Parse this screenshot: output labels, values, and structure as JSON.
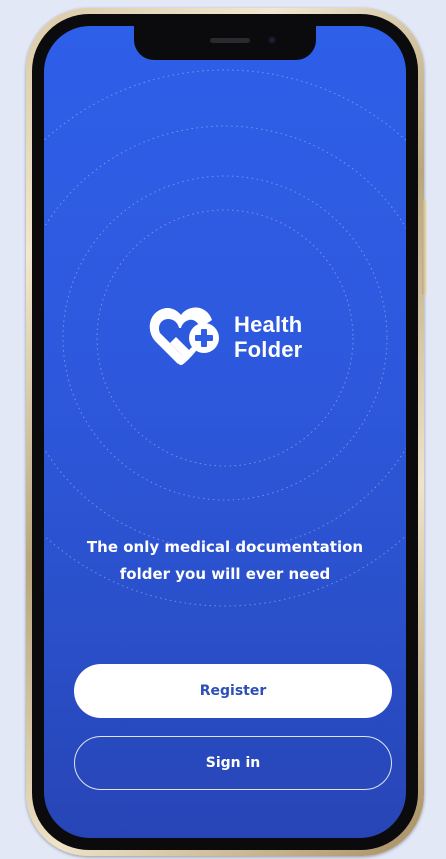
{
  "app": {
    "brand_line1": "Health",
    "brand_line2": "Folder",
    "logo_icon": "heart-plus-icon"
  },
  "welcome": {
    "tagline_line1": "The only medical documentation",
    "tagline_line2": "folder you will ever need"
  },
  "actions": {
    "register_label": "Register",
    "signin_label": "Sign in"
  },
  "colors": {
    "screen_top": "#2e5fe9",
    "screen_bottom": "#2745b6",
    "register_text": "#2c4fb8",
    "phone_frame": "#d9c9a6",
    "background": "#e3e8f7"
  }
}
